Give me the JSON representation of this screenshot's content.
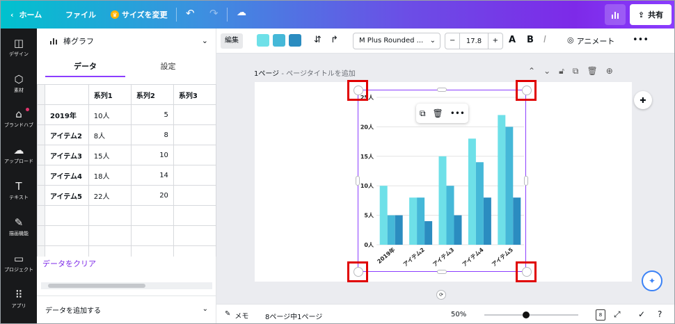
{
  "topbar": {
    "home_label": "ホーム",
    "file_label": "ファイル",
    "resize_label": "サイズを変更",
    "share_label": "共有",
    "icons": [
      "chevron-left-icon",
      "crown-icon",
      "undo-icon",
      "redo-icon",
      "cloud-save-icon",
      "chart-icon",
      "share-icon"
    ]
  },
  "rail": {
    "items": [
      {
        "label": "デザイン",
        "icon": "layout-icon"
      },
      {
        "label": "素材",
        "icon": "elements-icon"
      },
      {
        "label": "ブランドハブ",
        "icon": "brand-icon"
      },
      {
        "label": "アップロード",
        "icon": "upload-icon"
      },
      {
        "label": "テキスト",
        "icon": "text-icon"
      },
      {
        "label": "描画機能",
        "icon": "draw-icon"
      },
      {
        "label": "プロジェクト",
        "icon": "folder-icon"
      },
      {
        "label": "アプリ",
        "icon": "apps-icon"
      }
    ]
  },
  "panel": {
    "title": "棒グラフ",
    "tabs": {
      "data": "データ",
      "settings": "設定"
    },
    "table": {
      "headers": [
        "系列1",
        "系列2",
        "系列3"
      ],
      "rows": [
        {
          "label": "2019年",
          "s1": "10人",
          "s2": "5"
        },
        {
          "label": "アイテム2",
          "s1": "8人",
          "s2": "8"
        },
        {
          "label": "アイテム3",
          "s1": "15人",
          "s2": "10"
        },
        {
          "label": "アイテム4",
          "s1": "18人",
          "s2": "14"
        },
        {
          "label": "アイテム5",
          "s1": "22人",
          "s2": "20"
        }
      ]
    },
    "clear_label": "データをクリア",
    "add_data_label": "データを追加する"
  },
  "toolbar": {
    "edit_label": "編集",
    "colors": [
      "#6ee0e8",
      "#45b8d8",
      "#2b8cc0"
    ],
    "font_name": "M Plus Rounded ...",
    "font_size": "17.8",
    "animate_label": "アニメート"
  },
  "canvas": {
    "page_label": "1ページ",
    "page_title_placeholder": " - ページタイトルを追加"
  },
  "chart_data": {
    "type": "bar",
    "categories": [
      "2019年",
      "アイテム2",
      "アイテム3",
      "アイテム4",
      "アイテム5"
    ],
    "series": [
      {
        "values": [
          10,
          8,
          15,
          18,
          22
        ],
        "color": "#6ee0e8"
      },
      {
        "values": [
          5,
          8,
          10,
          14,
          20
        ],
        "color": "#45b8d8"
      },
      {
        "values": [
          5,
          4,
          5,
          8,
          8
        ],
        "color": "#2b8cc0"
      }
    ],
    "y_ticks": [
      "0人",
      "5人",
      "10人",
      "15人",
      "20人",
      "25人"
    ],
    "ylim": [
      0,
      25
    ],
    "grid": true
  },
  "status": {
    "memo_label": "メモ",
    "page_info": "8ページ中1ページ",
    "zoom": "50%",
    "page_count": "8"
  }
}
